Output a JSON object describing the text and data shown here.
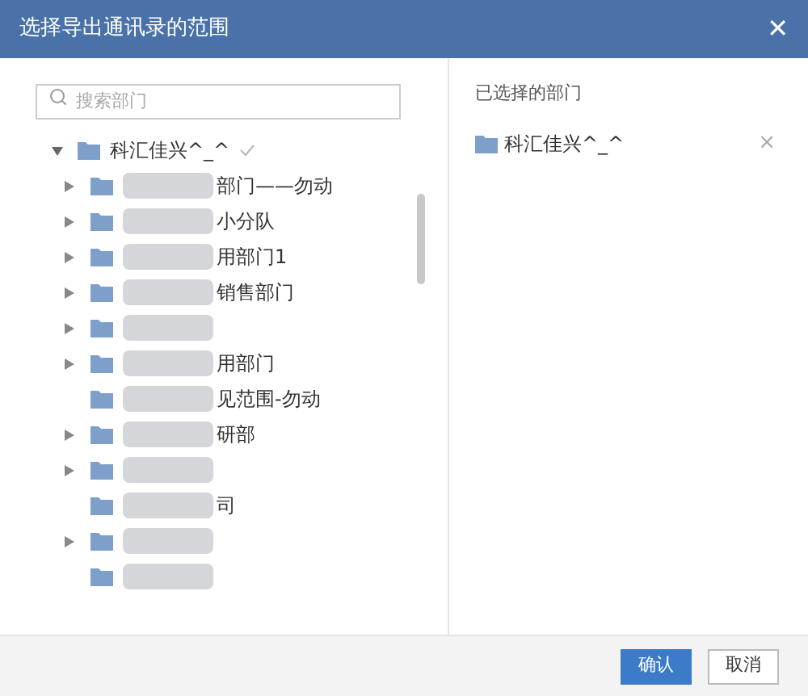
{
  "window": {
    "title": "选择导出通讯录的范围",
    "close": "✕"
  },
  "search": {
    "placeholder": "搜索部门"
  },
  "tree": {
    "label": "科汇佳兴^_^",
    "expanded": true,
    "selected": true,
    "children": [
      {
        "label": "部门——勿动",
        "expandable": true
      },
      {
        "label": "小分队",
        "expandable": true
      },
      {
        "label": "用部门1",
        "expandable": true
      },
      {
        "label": "销售部门",
        "expandable": true
      },
      {
        "expandable": true
      },
      {
        "label": "用部门",
        "expandable": true
      },
      {
        "label": "见范围-勿动",
        "expandable": false
      },
      {
        "label": "研部",
        "expandable": true
      },
      {
        "expandable": true
      },
      {
        "label": "司",
        "expandable": false
      },
      {
        "expandable": true
      },
      {
        "expandable": false
      }
    ]
  },
  "selected_panel": {
    "title": "已选择的部门",
    "items": [
      {
        "label": "科汇佳兴^_^",
        "remove": "×"
      }
    ]
  },
  "buttons": [
    {
      "label": "确认",
      "kind": "primary"
    },
    {
      "label": "取消",
      "kind": "secondary"
    }
  ]
}
